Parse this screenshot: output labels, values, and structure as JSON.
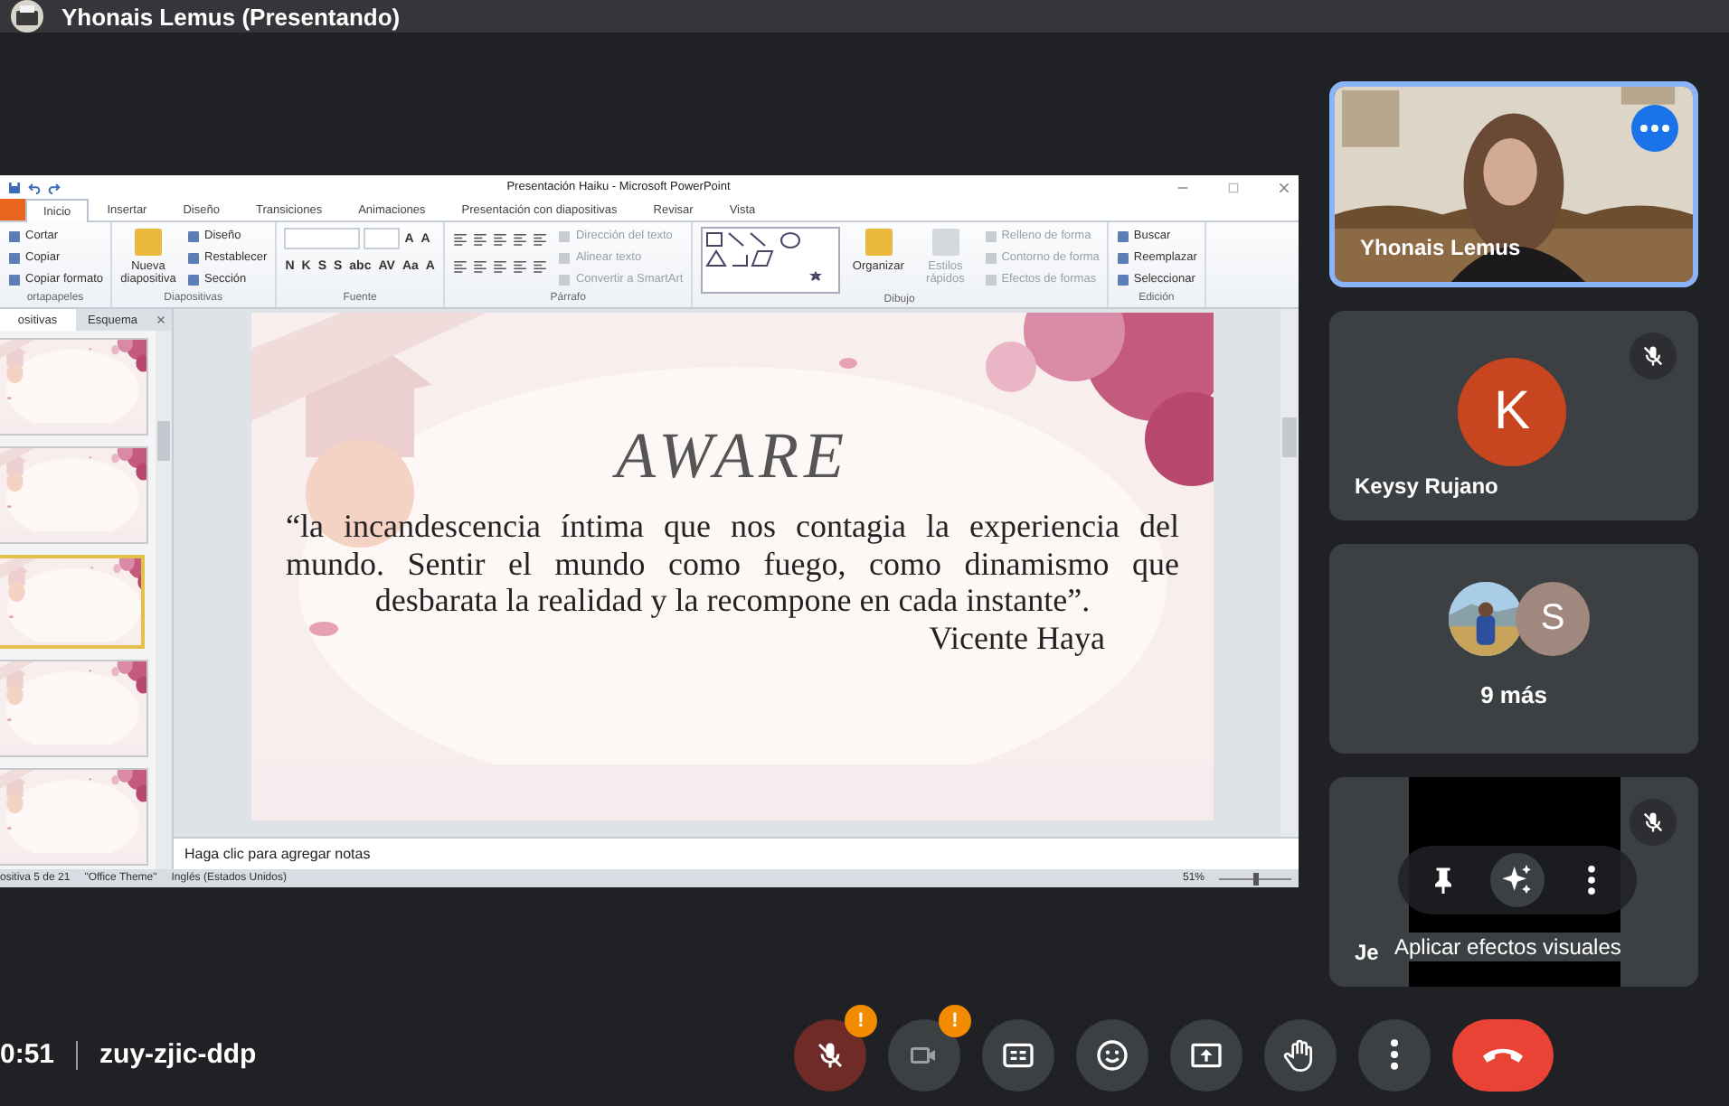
{
  "presenter_bar": {
    "title": "Yhonais Lemus (Presentando)"
  },
  "shared_screen": {
    "window_title": "Presentación Haiku - Microsoft PowerPoint",
    "ribbon_tabs": [
      {
        "label": "Inicio",
        "selected": true
      },
      {
        "label": "Insertar",
        "selected": false
      },
      {
        "label": "Diseño",
        "selected": false
      },
      {
        "label": "Transiciones",
        "selected": false
      },
      {
        "label": "Animaciones",
        "selected": false
      },
      {
        "label": "Presentación con diapositivas",
        "selected": false
      },
      {
        "label": "Revisar",
        "selected": false
      },
      {
        "label": "Vista",
        "selected": false
      }
    ],
    "ribbon_groups": [
      {
        "label": "ortapapeles",
        "columns": [
          [
            {
              "kind": "small",
              "label": "Cortar",
              "disabled": false
            },
            {
              "kind": "small",
              "label": "Copiar",
              "disabled": false
            },
            {
              "kind": "small",
              "label": "Copiar formato",
              "disabled": false
            }
          ]
        ]
      },
      {
        "label": "Diapositivas",
        "columns": [
          [
            {
              "kind": "large",
              "label": "Nueva diapositiva",
              "disabled": false
            }
          ],
          [
            {
              "kind": "small",
              "label": "Diseño",
              "disabled": false
            },
            {
              "kind": "small",
              "label": "Restablecer",
              "disabled": false
            },
            {
              "kind": "small",
              "label": "Sección",
              "disabled": false
            }
          ]
        ]
      },
      {
        "label": "Fuente",
        "columns": [
          [
            {
              "kind": "toolrow",
              "items": [
                {
                  "kind": "field"
                },
                {
                  "kind": "field"
                },
                {
                  "kind": "glyph",
                  "label": "A"
                },
                {
                  "kind": "glyph",
                  "label": "A"
                }
              ]
            },
            {
              "kind": "toolrow",
              "items": [
                {
                  "kind": "glyph",
                  "label": "N"
                },
                {
                  "kind": "glyph",
                  "label": "K"
                },
                {
                  "kind": "glyph",
                  "label": "S"
                },
                {
                  "kind": "glyph",
                  "label": "S"
                },
                {
                  "kind": "glyph",
                  "label": "abc"
                },
                {
                  "kind": "glyph",
                  "label": "AV"
                },
                {
                  "kind": "glyph",
                  "label": "Aa"
                },
                {
                  "kind": "glyph",
                  "label": "A"
                }
              ]
            }
          ]
        ]
      },
      {
        "label": "Párrafo",
        "columns": [
          [
            {
              "kind": "toolrow",
              "items": [
                {
                  "kind": "icon"
                },
                {
                  "kind": "icon"
                },
                {
                  "kind": "icon"
                },
                {
                  "kind": "icon"
                },
                {
                  "kind": "icon"
                }
              ]
            },
            {
              "kind": "toolrow",
              "items": [
                {
                  "kind": "icon"
                },
                {
                  "kind": "icon"
                },
                {
                  "kind": "icon"
                },
                {
                  "kind": "icon"
                },
                {
                  "kind": "icon"
                }
              ]
            }
          ],
          [
            {
              "kind": "small",
              "label": "Dirección del texto",
              "disabled": true
            },
            {
              "kind": "small",
              "label": "Alinear texto",
              "disabled": true
            },
            {
              "kind": "small",
              "label": "Convertir a SmartArt",
              "disabled": true
            }
          ]
        ]
      },
      {
        "label": "Dibujo",
        "columns": [
          [
            {
              "kind": "gallery"
            }
          ],
          [
            {
              "kind": "large",
              "label": "Organizar",
              "disabled": false
            }
          ],
          [
            {
              "kind": "large",
              "label": "Estilos rápidos",
              "disabled": true
            }
          ],
          [
            {
              "kind": "small",
              "label": "Relleno de forma",
              "disabled": true
            },
            {
              "kind": "small",
              "label": "Contorno de forma",
              "disabled": true
            },
            {
              "kind": "small",
              "label": "Efectos de formas",
              "disabled": true
            }
          ]
        ]
      },
      {
        "label": "Edición",
        "columns": [
          [
            {
              "kind": "small",
              "label": "Buscar",
              "disabled": false
            },
            {
              "kind": "small",
              "label": "Reemplazar",
              "disabled": false
            },
            {
              "kind": "small",
              "label": "Seleccionar",
              "disabled": false
            }
          ]
        ]
      }
    ],
    "panel_tabs": [
      {
        "label": "ositivas",
        "selected": true
      },
      {
        "label": "Esquema",
        "selected": false
      }
    ],
    "thumbnails": [
      {
        "selected": false
      },
      {
        "selected": false
      },
      {
        "selected": true
      },
      {
        "selected": false
      },
      {
        "selected": false
      }
    ],
    "slide": {
      "title": "AWARE",
      "quote": "“la incandescencia íntima que nos contagia la experiencia del mundo. Sentir el mundo como fuego, como dinamismo que desbarata la realidad  y la recompone en cada instante”.",
      "author": "Vicente Haya"
    },
    "notes": {
      "placeholder": "Haga clic para agregar notas"
    },
    "status_bar": {
      "slide_counter": "ositiva 5 de 21",
      "theme": "\"Office Theme\"",
      "language": "Inglés (Estados Unidos)",
      "zoom": "51%",
      "zoom_slider": {
        "level": 0.5
      }
    }
  },
  "participants": [
    {
      "kind": "video",
      "name": "Yhonais Lemus",
      "highlighted": true,
      "muted": false
    },
    {
      "kind": "avatar",
      "name": "Keysy Rujano",
      "initial": "K",
      "color": "#c8461f",
      "muted": true,
      "highlighted": false
    },
    {
      "kind": "group",
      "label": "9 más",
      "avatars": [
        {
          "kind": "picture"
        },
        {
          "kind": "initial",
          "initial": "S",
          "color": "#a1887f"
        }
      ]
    },
    {
      "kind": "hover",
      "name": "Je",
      "muted": true,
      "highlighted": false,
      "tooltip": "Aplicar efectos visuales"
    }
  ],
  "call_bar": {
    "time": "0:51",
    "meeting_code": "zuy-zjic-ddp",
    "controls": [
      {
        "kind": "mic",
        "muted": true,
        "alert": "!"
      },
      {
        "kind": "camera",
        "alert": "!"
      },
      {
        "kind": "captions"
      },
      {
        "kind": "emoji"
      },
      {
        "kind": "present"
      },
      {
        "kind": "hand"
      },
      {
        "kind": "more"
      },
      {
        "kind": "end"
      }
    ]
  }
}
